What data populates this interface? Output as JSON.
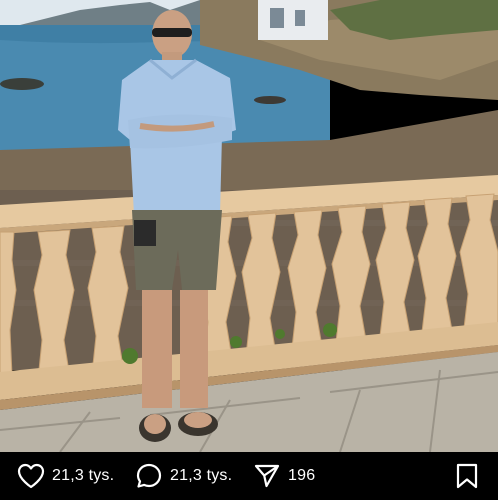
{
  "post": {
    "photo": {
      "subject": "",
      "scene": ""
    }
  },
  "actions": {
    "like": {
      "icon": "heart-icon",
      "count": "21,3 tys."
    },
    "comment": {
      "icon": "comment-icon",
      "count": "21,3 tys."
    },
    "share": {
      "icon": "send-icon",
      "count": "196"
    },
    "save": {
      "icon": "bookmark-icon"
    }
  },
  "colors": {
    "bar_background": "#000000",
    "bar_text": "#ffffff"
  }
}
